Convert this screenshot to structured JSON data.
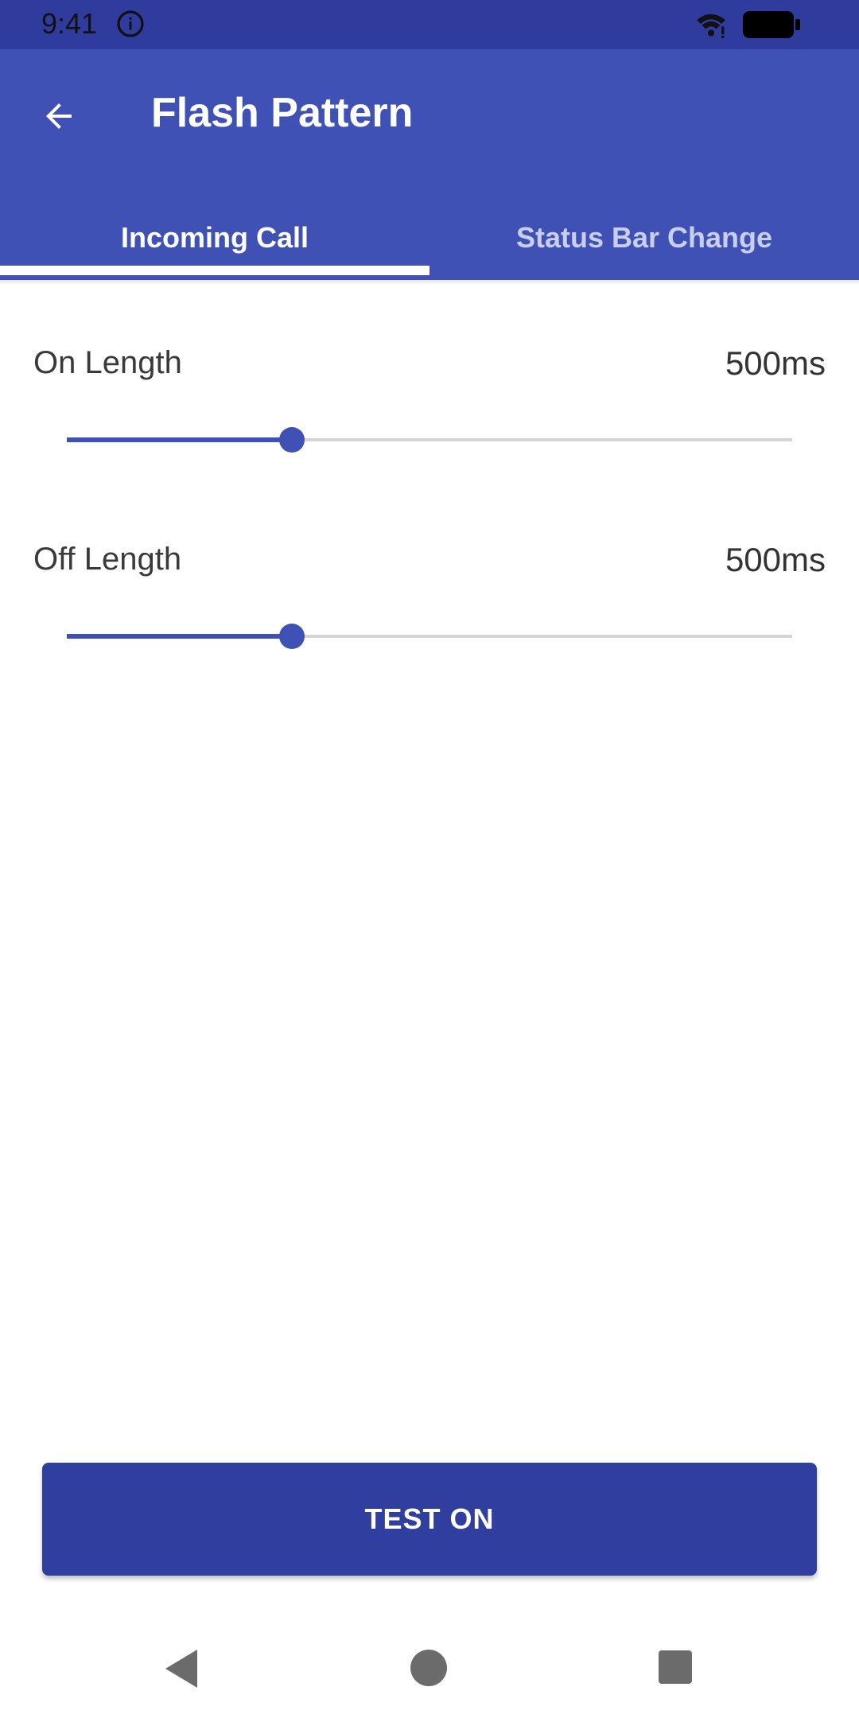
{
  "status_bar": {
    "time": "9:41",
    "info_icon": "info-circle-icon",
    "wifi_icon": "wifi-icon",
    "battery_icon": "battery-full-icon"
  },
  "app_bar": {
    "title": "Flash Pattern",
    "back_icon": "arrow-back-icon",
    "background": "#3f51b5"
  },
  "tabs": [
    {
      "label": "Incoming Call",
      "selected": true
    },
    {
      "label": "Status Bar Change",
      "selected": false
    }
  ],
  "settings": [
    {
      "label": "On Length",
      "value_text": "500ms",
      "slider_fraction": 0.31
    },
    {
      "label": "Off Length",
      "value_text": "500ms",
      "slider_fraction": 0.31
    }
  ],
  "actions": {
    "test_label": "TEST ON"
  },
  "nav_bar": {
    "back_icon": "triangle-back-icon",
    "home_icon": "circle-home-icon",
    "recents_icon": "square-recents-icon"
  },
  "colors": {
    "primary": "#3f51b5",
    "primary_dark": "#303f9f",
    "status_bar": "#2f3c9e"
  }
}
